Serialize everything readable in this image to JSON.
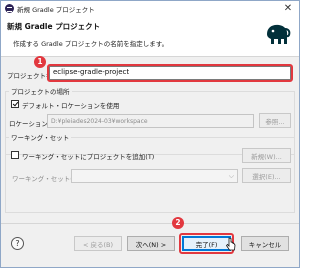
{
  "window": {
    "title": "新規 Gradle プロジェクト",
    "close_glyph": "✕"
  },
  "banner": {
    "title": "新規 Gradle プロジェクト",
    "description": "作成する Gradle プロジェクトの名前を指定します。"
  },
  "project_name": {
    "label": "プロジェクト名",
    "value": "eclipse-gradle-project"
  },
  "location": {
    "section_label": "プロジェクトの場所",
    "use_default_label": "デフォルト・ロケーションを使用",
    "use_default_checked": true,
    "location_label": "ロケーション",
    "location_value": "D:¥pleiades2024-03¥workspace",
    "browse_label": "参照..."
  },
  "working_set": {
    "section_label": "ワーキング・セット",
    "add_label": "ワーキング・セットにプロジェクトを追加(T)",
    "add_checked": false,
    "new_label": "新規(W)...",
    "sets_label": "ワーキング・セット(O)",
    "select_label": "選択(E)..."
  },
  "footer": {
    "help_glyph": "?",
    "back_label": "< 戻る(B)",
    "next_label": "次へ(N) >",
    "finish_label": "完了(F)",
    "cancel_label": "キャンセル"
  },
  "annotations": {
    "step1": "1",
    "step2": "2"
  },
  "colors": {
    "annotation_red": "#e2383f",
    "primary_border": "#0078d7"
  }
}
